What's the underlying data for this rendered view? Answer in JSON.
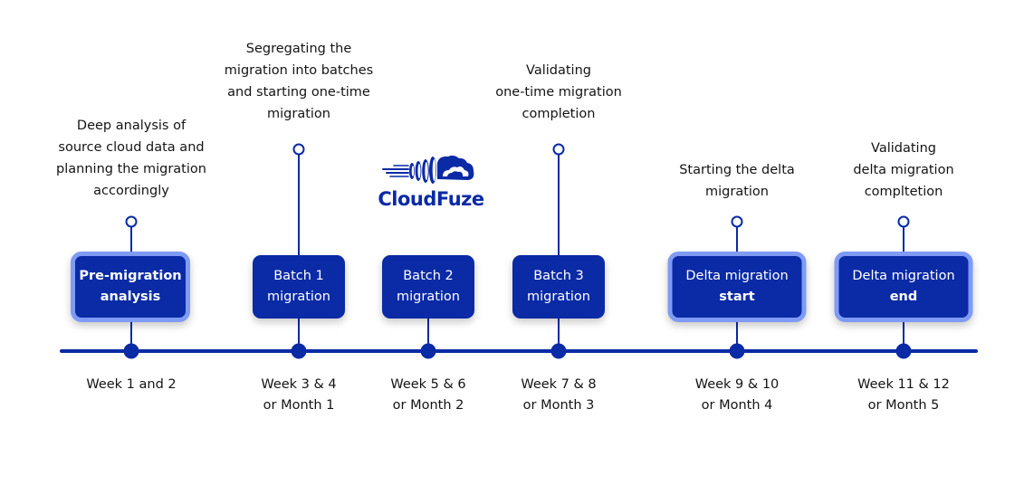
{
  "logo": {
    "text": "CloudFuze",
    "icon": "cloud-speed-icon"
  },
  "colors": {
    "primary": "#0a2aa6",
    "highlight_border": "#7f9bf5",
    "text": "#141414",
    "background": "#ffffff"
  },
  "milestones": [
    {
      "description": "Deep analysis of\nsource cloud data and\nplanning the migration\naccordingly",
      "label_line1": "Pre-migration",
      "label_line2": "analysis",
      "label_bold": "all",
      "highlighted": true,
      "period": "Week 1 and 2"
    },
    {
      "description": "Segregating the\nmigration into batches\nand starting one-time\nmigration",
      "label_line1": "Batch 1",
      "label_line2": "migration",
      "label_bold": "none",
      "highlighted": false,
      "period": "Week 3 & 4\nor Month 1"
    },
    {
      "description": "",
      "label_line1": "Batch 2",
      "label_line2": "migration",
      "label_bold": "none",
      "highlighted": false,
      "period": "Week 5 & 6\nor Month 2"
    },
    {
      "description": "Validating\none-time migration\ncompletion",
      "label_line1": "Batch 3",
      "label_line2": "migration",
      "label_bold": "none",
      "highlighted": false,
      "period": "Week 7 & 8\nor Month 3"
    },
    {
      "description": "Starting the delta\nmigration",
      "label_line1": "Delta migration",
      "label_line2": "start",
      "label_bold": "line2",
      "highlighted": true,
      "period": "Week 9 & 10\nor Month 4"
    },
    {
      "description": "Validating\ndelta migration\ncompltetion",
      "label_line1": "Delta migration",
      "label_line2": "end",
      "label_bold": "line2",
      "highlighted": true,
      "period": "Week 11 & 12\nor Month 5"
    }
  ]
}
